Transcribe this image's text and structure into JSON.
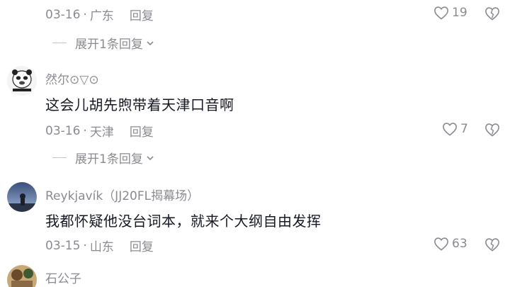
{
  "comments": [
    {
      "date": "03-16",
      "location": "广东",
      "reply_label": "回复",
      "likes": "19",
      "expand_label": "展开1条回复"
    },
    {
      "username": "然尔⊙▽⊙",
      "text": "这会儿胡先煦带着天津口音啊",
      "date": "03-16",
      "location": "天津",
      "reply_label": "回复",
      "likes": "7",
      "expand_label": "展开1条回复"
    },
    {
      "username": "Reykjavík（JJ20FL揭幕场）",
      "text": "我都怀疑他没台词本，就来个大纲自由发挥",
      "date": "03-15",
      "location": "山东",
      "reply_label": "回复",
      "likes": "63"
    },
    {
      "username": "石公子"
    }
  ],
  "separator": "·",
  "icons": {
    "like": "heart-outline-icon",
    "dislike": "heart-broken-icon",
    "expand": "chevron-down-icon"
  },
  "colors": {
    "text": "#161823",
    "meta": "#8a8b91"
  }
}
